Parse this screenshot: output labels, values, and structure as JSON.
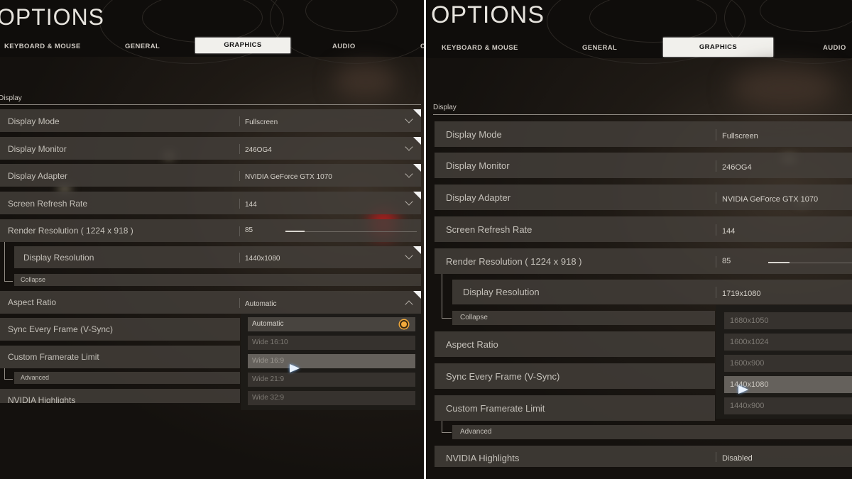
{
  "left": {
    "title": "OPTIONS",
    "tabs": [
      "KEYBOARD & MOUSE",
      "GENERAL",
      "GRAPHICS",
      "AUDIO",
      "C"
    ],
    "active_tab": "GRAPHICS",
    "section": "Display",
    "rows": [
      {
        "label": "Display Mode",
        "value": "Fullscreen"
      },
      {
        "label": "Display Monitor",
        "value": "246OG4"
      },
      {
        "label": "Display Adapter",
        "value": "NVIDIA GeForce GTX 1070"
      },
      {
        "label": "Screen Refresh Rate",
        "value": "144"
      },
      {
        "label": "Render Resolution ( 1224 x 918 )",
        "value": "85"
      },
      {
        "label": "Display Resolution",
        "value": "1440x1080"
      },
      {
        "label": "Collapse",
        "value": ""
      },
      {
        "label": "Aspect Ratio",
        "value": "Automatic"
      },
      {
        "label": "Sync Every Frame (V-Sync)",
        "value": ""
      },
      {
        "label": "Custom Framerate Limit",
        "value": ""
      },
      {
        "label": "Advanced",
        "value": ""
      },
      {
        "label": "NVIDIA Highlights",
        "value": ""
      }
    ],
    "dropdown_options": [
      "Automatic",
      "Wide 16:10",
      "Wide 16:9",
      "Wide 21:9",
      "Wide 32:9"
    ],
    "dropdown_selected": "Automatic"
  },
  "right": {
    "title": "OPTIONS",
    "tabs": [
      "KEYBOARD & MOUSE",
      "GENERAL",
      "GRAPHICS",
      "AUDIO"
    ],
    "active_tab": "GRAPHICS",
    "section": "Display",
    "rows": [
      {
        "label": "Display Mode",
        "value": "Fullscreen"
      },
      {
        "label": "Display Monitor",
        "value": "246OG4"
      },
      {
        "label": "Display Adapter",
        "value": "NVIDIA GeForce GTX 1070"
      },
      {
        "label": "Screen Refresh Rate",
        "value": "144"
      },
      {
        "label": "Render Resolution ( 1224 x 918 )",
        "value": "85"
      },
      {
        "label": "Display Resolution",
        "value": "1719x1080"
      },
      {
        "label": "Collapse",
        "value": ""
      },
      {
        "label": "Aspect Ratio",
        "value": ""
      },
      {
        "label": "Sync Every Frame (V-Sync)",
        "value": ""
      },
      {
        "label": "Custom Framerate Limit",
        "value": ""
      },
      {
        "label": "Advanced",
        "value": ""
      },
      {
        "label": "NVIDIA Highlights",
        "value": "Disabled"
      }
    ],
    "dropdown_options": [
      "1680x1050",
      "1600x1024",
      "1600x900",
      "1440x1080",
      "1440x900"
    ]
  },
  "render_resolution_percent": 85,
  "colors": {
    "accent": "#f2a93b",
    "active_tab_bg": "#f1f0ec",
    "row_bg": "#443f3a"
  },
  "icons": {
    "dropdown": "chevron-down-icon",
    "selected": "radio-selected-icon",
    "pointer": "cursor-arrow-icon"
  }
}
